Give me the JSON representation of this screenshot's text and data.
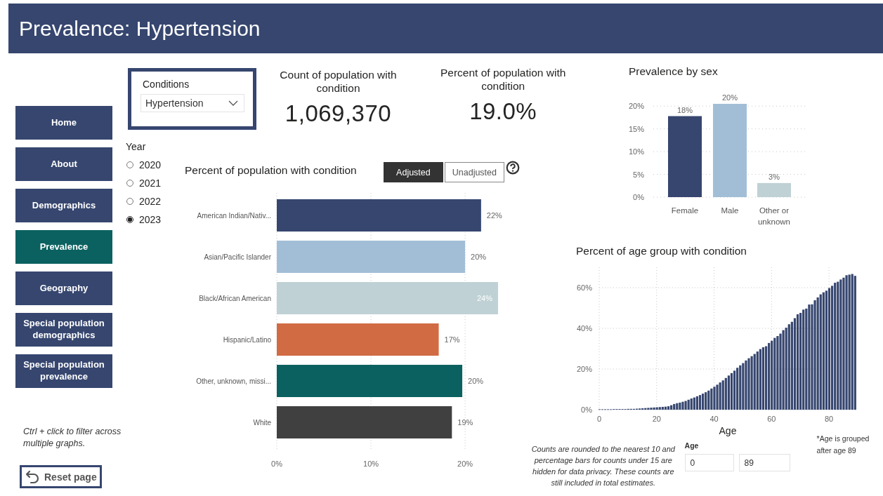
{
  "header": {
    "title": "Prevalence: Hypertension"
  },
  "nav": {
    "items": [
      {
        "label": "Home",
        "selected": false
      },
      {
        "label": "About",
        "selected": false
      },
      {
        "label": "Demographics",
        "selected": false
      },
      {
        "label": "Prevalence",
        "selected": true
      },
      {
        "label": "Geography",
        "selected": false
      },
      {
        "label": "Special population demographics",
        "selected": false
      },
      {
        "label": "Special population prevalence",
        "selected": false
      }
    ]
  },
  "hint": "Ctrl + click to filter across multiple graphs.",
  "reset_button": {
    "label": "Reset page"
  },
  "conditions": {
    "label": "Conditions",
    "value": "Hypertension"
  },
  "year": {
    "label": "Year",
    "options": [
      {
        "label": "2020",
        "selected": false
      },
      {
        "label": "2021",
        "selected": false
      },
      {
        "label": "2022",
        "selected": false
      },
      {
        "label": "2023",
        "selected": true
      }
    ]
  },
  "kpis": [
    {
      "title": "Count of population with condition",
      "value": "1,069,370"
    },
    {
      "title": "Percent of population with condition",
      "value": "19.0%"
    }
  ],
  "race_chart": {
    "toggles": [
      {
        "label": "Adjusted",
        "selected": true
      },
      {
        "label": "Unadjusted",
        "selected": false
      }
    ],
    "chart_data": {
      "type": "bar",
      "orientation": "horizontal",
      "title": "Percent of population with condition",
      "categories": [
        "American Indian/Nativ...",
        "Asian/Pacific Islander",
        "Black/African American",
        "Hispanic/Latino",
        "Other, unknown, missi...",
        "White"
      ],
      "values": [
        21.7,
        20.0,
        23.5,
        17.2,
        19.7,
        18.6
      ],
      "grid": true,
      "colors": [
        "#36466f",
        "#a2bed7",
        "#bfd1d4",
        "#d16b43",
        "#0b6160",
        "#404041"
      ],
      "value_labels": [
        "22%",
        "20%",
        "24%",
        "17%",
        "20%",
        "19%"
      ],
      "xlim": [
        0,
        23.5
      ],
      "xticks": [
        {
          "value": 0,
          "label": "0%"
        },
        {
          "value": 10,
          "label": "10%"
        },
        {
          "value": 20,
          "label": "20%"
        }
      ]
    }
  },
  "sex_chart": {
    "chart_data": {
      "type": "bar",
      "title": "Prevalence by sex",
      "categories": [
        "Female",
        "Male",
        "Other or unknown"
      ],
      "values": [
        17.8,
        20.5,
        3.1
      ],
      "grid": true,
      "colors": [
        "#36466f",
        "#a2bed7",
        "#bfd1d4"
      ],
      "value_labels": [
        "18%",
        "20%",
        "3%"
      ],
      "ylim": [
        0,
        20.5
      ],
      "yticks": [
        {
          "value": 0,
          "label": "0%"
        },
        {
          "value": 5,
          "label": "5%"
        },
        {
          "value": 10,
          "label": "10%"
        },
        {
          "value": 15,
          "label": "15%"
        },
        {
          "value": 20,
          "label": "20%"
        }
      ]
    }
  },
  "age_chart": {
    "chart_data": {
      "type": "bar",
      "title": "Percent of age group with condition",
      "xlabel": "Age",
      "x": [
        0,
        1,
        2,
        3,
        4,
        5,
        6,
        7,
        8,
        9,
        10,
        11,
        12,
        13,
        14,
        15,
        16,
        17,
        18,
        19,
        20,
        21,
        22,
        23,
        24,
        25,
        26,
        27,
        28,
        29,
        30,
        31,
        32,
        33,
        34,
        35,
        36,
        37,
        38,
        39,
        40,
        41,
        42,
        43,
        44,
        45,
        46,
        47,
        48,
        49,
        50,
        51,
        52,
        53,
        54,
        55,
        56,
        57,
        58,
        59,
        60,
        61,
        62,
        63,
        64,
        65,
        66,
        67,
        68,
        69,
        70,
        71,
        72,
        73,
        74,
        75,
        76,
        77,
        78,
        79,
        80,
        81,
        82,
        83,
        84,
        85,
        86,
        87,
        88,
        89
      ],
      "grid": true,
      "series": [
        {
          "color": "#36466f",
          "values": [
            0.2,
            0.2,
            0.2,
            0.2,
            0.2,
            0.3,
            0.3,
            0.3,
            0.3,
            0.3,
            0.4,
            0.4,
            0.4,
            0.5,
            0.6,
            0.7,
            0.8,
            0.9,
            1.0,
            1.1,
            1.2,
            1.3,
            1.4,
            1.5,
            1.7,
            2.2,
            2.8,
            3.2,
            3.5,
            3.9,
            4.3,
            4.9,
            5.5,
            6.0,
            6.6,
            7.2,
            7.9,
            8.6,
            9.4,
            10.4,
            11.3,
            12.3,
            13.4,
            14.4,
            15.6,
            16.8,
            18.0,
            19.2,
            20.6,
            21.8,
            22.9,
            24.2,
            25.3,
            26.3,
            27.4,
            28.6,
            29.8,
            30.7,
            31.2,
            32.8,
            33.9,
            35.3,
            36.2,
            37.4,
            39.1,
            40.3,
            42.0,
            43.2,
            45.0,
            46.9,
            47.6,
            49.2,
            49.7,
            51.7,
            51.8,
            53.8,
            55.2,
            56.7,
            57.7,
            58.5,
            59.8,
            60.9,
            62.4,
            62.9,
            64.0,
            64.9,
            66.1,
            66.4,
            66.7,
            65.8
          ]
        }
      ],
      "xlim": [
        0,
        90
      ],
      "ylim": [
        0,
        70
      ],
      "xticks": [
        0,
        20,
        40,
        60,
        80
      ],
      "yticks": [
        {
          "value": 0,
          "label": "0%"
        },
        {
          "value": 20,
          "label": "20%"
        },
        {
          "value": 40,
          "label": "40%"
        },
        {
          "value": 60,
          "label": "60%"
        }
      ]
    },
    "footnote": "*Age is grouped after age 89"
  },
  "privacy_note": "Counts are rounded to the nearest 10 and percentage bars for counts under 15 are hidden for data privacy. These counts are still included in total estimates.",
  "age_filter": {
    "label": "Age",
    "min": "0",
    "max": "89"
  }
}
